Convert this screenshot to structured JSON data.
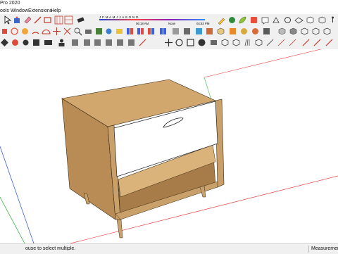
{
  "window": {
    "title": "Pro 2020"
  },
  "menu": {
    "items": [
      "ools",
      "Window",
      "Extensions",
      "Help"
    ]
  },
  "shadows": {
    "months": "J F M A M J J A S O N D",
    "time_start": "06:18 AM",
    "time_noon": "Noon",
    "time_end": "04:53 PM"
  },
  "colors": {
    "wood": "#c49a63",
    "wood_dark": "#8d6a3e",
    "drawer_front": "#ffffff",
    "red_axis": "#e84040",
    "green_axis": "#3cb043",
    "blue_axis": "#3b5fe0"
  },
  "toolbar": {
    "row1": [
      "select-icon",
      "paint-bucket-icon",
      "eraser-icon",
      "line-icon",
      "rectangle-icon",
      "dimension-grid-icon",
      "warehouse-icon",
      "pencil-icon",
      "sandbox-icon",
      "leaf-icon",
      "extension-icon",
      "warehouse-share-icon",
      "trace-icon",
      "refresh-icon",
      "tape-icon",
      "cube-icon",
      "cube-outline-icon",
      "walkthrough-icon"
    ],
    "row2": [
      "push-pull-icon",
      "paint-icon",
      "orbit-icon",
      "arc-icon",
      "protractor-icon",
      "rotate-icon",
      "pan-icon",
      "zoom-icon",
      "camera-icon",
      "section-icon",
      "layers-icon",
      "styles-icon",
      "fog-icon",
      "xray-icon",
      "components-icon",
      "materials-icon",
      "entity-icon",
      "ruby-icon",
      "views-icon",
      "axes-icon",
      "iso-icon",
      "top-icon",
      "front-icon",
      "right-icon",
      "back-icon",
      "left-icon"
    ],
    "row3": [
      "scale-icon",
      "follow-me-icon",
      "outer-shell-icon",
      "intersect-icon",
      "mail-icon",
      "user-icon",
      "intersect-faces-icon",
      "solid-tools-icon",
      "subtract-icon",
      "trim-icon",
      "split-icon",
      "add-scene-icon",
      "sketch-icon",
      "move-icon",
      "rotate-icon",
      "scale-box-icon",
      "help-icon",
      "photo-icon",
      "section-plane-icon",
      "orbit-cam-icon",
      "standard-cube-icon",
      "texture-icon",
      "fur-icon",
      "dimension-icon",
      "offset-icon",
      "gear-icon",
      "close-icon",
      "axes-toggle-icon",
      "drawing-icon",
      "edge-icon",
      "vertex-icon"
    ]
  },
  "status": {
    "hint": "ouse to select multiple.",
    "measurements_label": "Measurements"
  }
}
